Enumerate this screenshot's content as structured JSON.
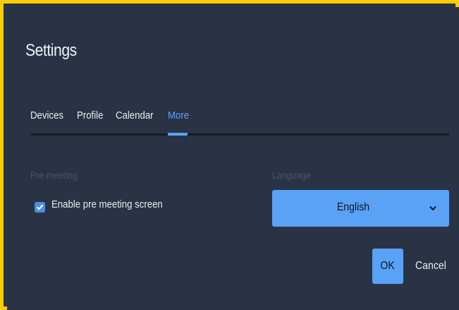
{
  "dialog": {
    "title": "Settings"
  },
  "tabs": [
    {
      "label": "Devices",
      "active": false
    },
    {
      "label": "Profile",
      "active": false
    },
    {
      "label": "Calendar",
      "active": false
    },
    {
      "label": "More",
      "active": true
    }
  ],
  "pre_meeting": {
    "section_label": "Pre meeting",
    "checkbox_label": "Enable pre meeting screen",
    "checked": true
  },
  "language": {
    "section_label": "Language",
    "selected": "English"
  },
  "actions": {
    "ok_label": "OK",
    "cancel_label": "Cancel"
  },
  "colors": {
    "background": "#2a3345",
    "accent": "#5aa2f6",
    "frame": "#fccd06",
    "muted": "#4a5568"
  },
  "icons": {
    "checkbox": "checkmark-icon",
    "select": "chevron-down-icon"
  }
}
